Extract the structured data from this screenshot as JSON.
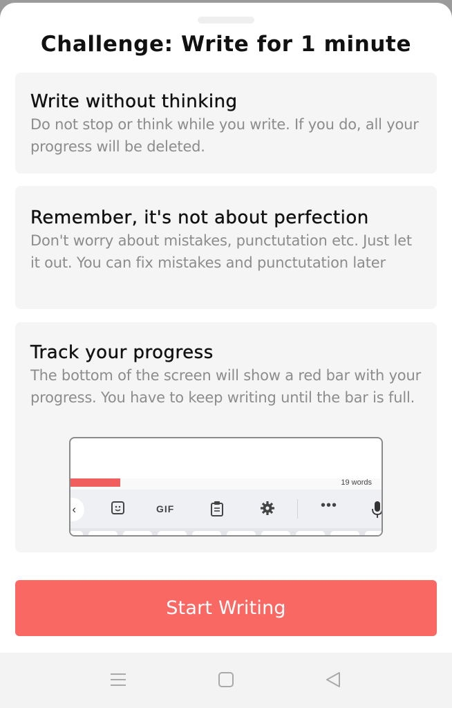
{
  "dialog": {
    "title": "Challenge: Write for 1 minute"
  },
  "cards": [
    {
      "heading": "Write without thinking",
      "text": "Do not stop or think while you write. If you do, all your progress will be deleted."
    },
    {
      "heading": "Remember, it's not about perfection",
      "text": "Don't worry about mistakes, punctutation etc. Just let it out. You can fix mistakes and punctutation later"
    },
    {
      "heading": "Track your progress",
      "text": "The bottom of the screen will show a red bar with your progress. You have to keep writing until the bar is full."
    }
  ],
  "preview": {
    "word_count_label": "19 words",
    "progress_fraction": 0.16,
    "progress_color": "#f05f5e",
    "keyboard": {
      "back_glyph": "‹",
      "gif_label": "GIF",
      "more_glyph": "•••",
      "icons": [
        "chevron-left-icon",
        "sticker-icon",
        "gif-icon",
        "clipboard-icon",
        "gear-icon",
        "more-icon",
        "microphone-icon"
      ]
    }
  },
  "actions": {
    "start_label": "Start Writing",
    "accent_color": "#fa6863"
  },
  "system_nav": {
    "icons": [
      "menu-icon",
      "home-icon",
      "back-icon"
    ]
  }
}
